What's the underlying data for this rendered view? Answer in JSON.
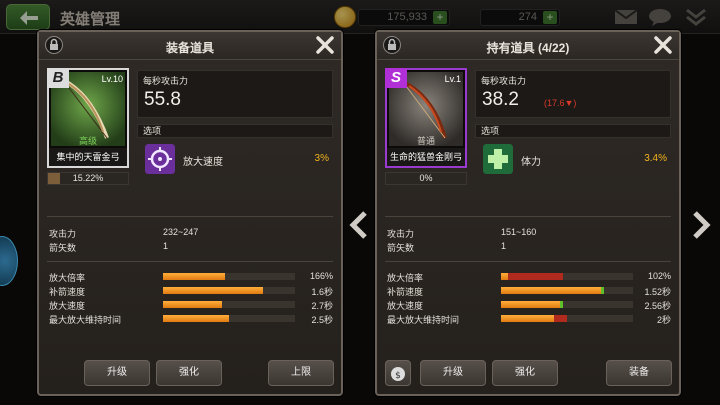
{
  "topbar": {
    "title": "英雄管理",
    "coins": "175,933",
    "gems": "274"
  },
  "left_panel": {
    "title": "装备道具",
    "item": {
      "grade": "B",
      "level": "Lv.10",
      "rarity": "高级",
      "name": "集中的天雷金弓",
      "exp": "15.22%",
      "exp_fraction": 0.1522
    },
    "dps_label": "每秒攻击力",
    "dps_value": "55.8",
    "options_label": "选项",
    "option": {
      "label": "放大速度",
      "value": "3%"
    },
    "stats": [
      {
        "label": "攻击力",
        "value": "232~247"
      },
      {
        "label": "箭矢数",
        "value": "1"
      }
    ],
    "bars": [
      {
        "label": "放大倍率",
        "value": "166%",
        "fill": 0.47
      },
      {
        "label": "补箭速度",
        "value": "1.6秒",
        "fill": 0.76
      },
      {
        "label": "放大速度",
        "value": "2.7秒",
        "fill": 0.45
      },
      {
        "label": "最大放大维持时间",
        "value": "2.5秒",
        "fill": 0.5
      }
    ],
    "buttons": {
      "upgrade": "升级",
      "enhance": "强化",
      "limit": "上限"
    }
  },
  "right_panel": {
    "title": "持有道具 (4/22)",
    "item": {
      "grade": "S",
      "level": "Lv.1",
      "rarity": "普通",
      "name": "生命的猛兽金刚弓",
      "exp": "0%",
      "exp_fraction": 0
    },
    "dps_label": "每秒攻击力",
    "dps_value": "38.2",
    "dps_delta": "(17.6▼)",
    "options_label": "选项",
    "option": {
      "label": "体力",
      "value": "3.4%"
    },
    "stats": [
      {
        "label": "攻击力",
        "value": "151~160"
      },
      {
        "label": "箭矢数",
        "value": "1"
      }
    ],
    "bars": [
      {
        "label": "放大倍率",
        "value": "102%",
        "fill": 0.05,
        "ext": 0.42,
        "ext_color": "#b02a1e"
      },
      {
        "label": "补箭速度",
        "value": "1.52秒",
        "fill": 0.76,
        "ext": 0.02,
        "ext_color": "#5fc02a"
      },
      {
        "label": "放大速度",
        "value": "2.56秒",
        "fill": 0.45,
        "ext": 0.02,
        "ext_color": "#5fc02a"
      },
      {
        "label": "最大放大维持时间",
        "value": "2秒",
        "fill": 0.4,
        "ext": 0.1,
        "ext_color": "#b02a1e"
      }
    ],
    "buttons": {
      "upgrade": "升级",
      "enhance": "强化",
      "equip": "装备"
    }
  },
  "colors": {
    "accent": "#f2b41e",
    "bar": "#f39a24",
    "negative": "#d93a2a",
    "positive": "#5fc02a"
  }
}
